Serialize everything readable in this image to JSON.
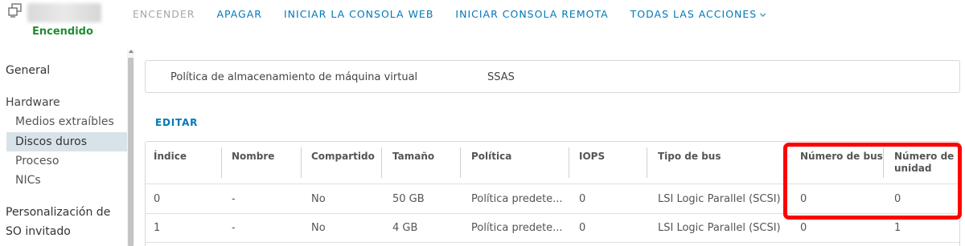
{
  "header": {
    "power_state": "Encendido",
    "actions": [
      {
        "label": "ENCENDER",
        "disabled": true
      },
      {
        "label": "APAGAR",
        "disabled": false
      },
      {
        "label": "INICIAR LA CONSOLA WEB",
        "disabled": false
      },
      {
        "label": "INICIAR CONSOLA REMOTA",
        "disabled": false
      },
      {
        "label": "TODAS LAS ACCIONES",
        "disabled": false
      }
    ]
  },
  "sidebar": {
    "general": "General",
    "hardware": "Hardware",
    "medios": "Medios extraíbles",
    "discos": "Discos duros",
    "proceso": "Proceso",
    "nics": "NICs",
    "personalizacion_1": "Personalización de",
    "personalizacion_2": "SO invitado",
    "selected": "Discos duros"
  },
  "policy": {
    "label": "Política de almacenamiento de máquina virtual",
    "value": "SSAS"
  },
  "edit_label": "EDITAR",
  "table": {
    "columns": [
      "Índice",
      "Nombre",
      "Compartido",
      "Tamaño",
      "Política",
      "IOPS",
      "Tipo de bus",
      "Número de bus",
      "Número de unidad"
    ],
    "col_unidad_line1": "Número de",
    "col_unidad_line2": "unidad",
    "rows": [
      [
        "0",
        "-",
        "No",
        "50 GB",
        "Política predete...",
        "0",
        "LSI Logic Parallel (SCSI)",
        "0",
        "0"
      ],
      [
        "1",
        "-",
        "No",
        "4 GB",
        "Política predete...",
        "0",
        "LSI Logic Parallel (SCSI)",
        "0",
        "1"
      ]
    ]
  },
  "colors": {
    "accent": "#0079b8",
    "power_on": "#1e8c33",
    "highlight": "#ff0000",
    "selected_bg": "#d8e3e9"
  }
}
